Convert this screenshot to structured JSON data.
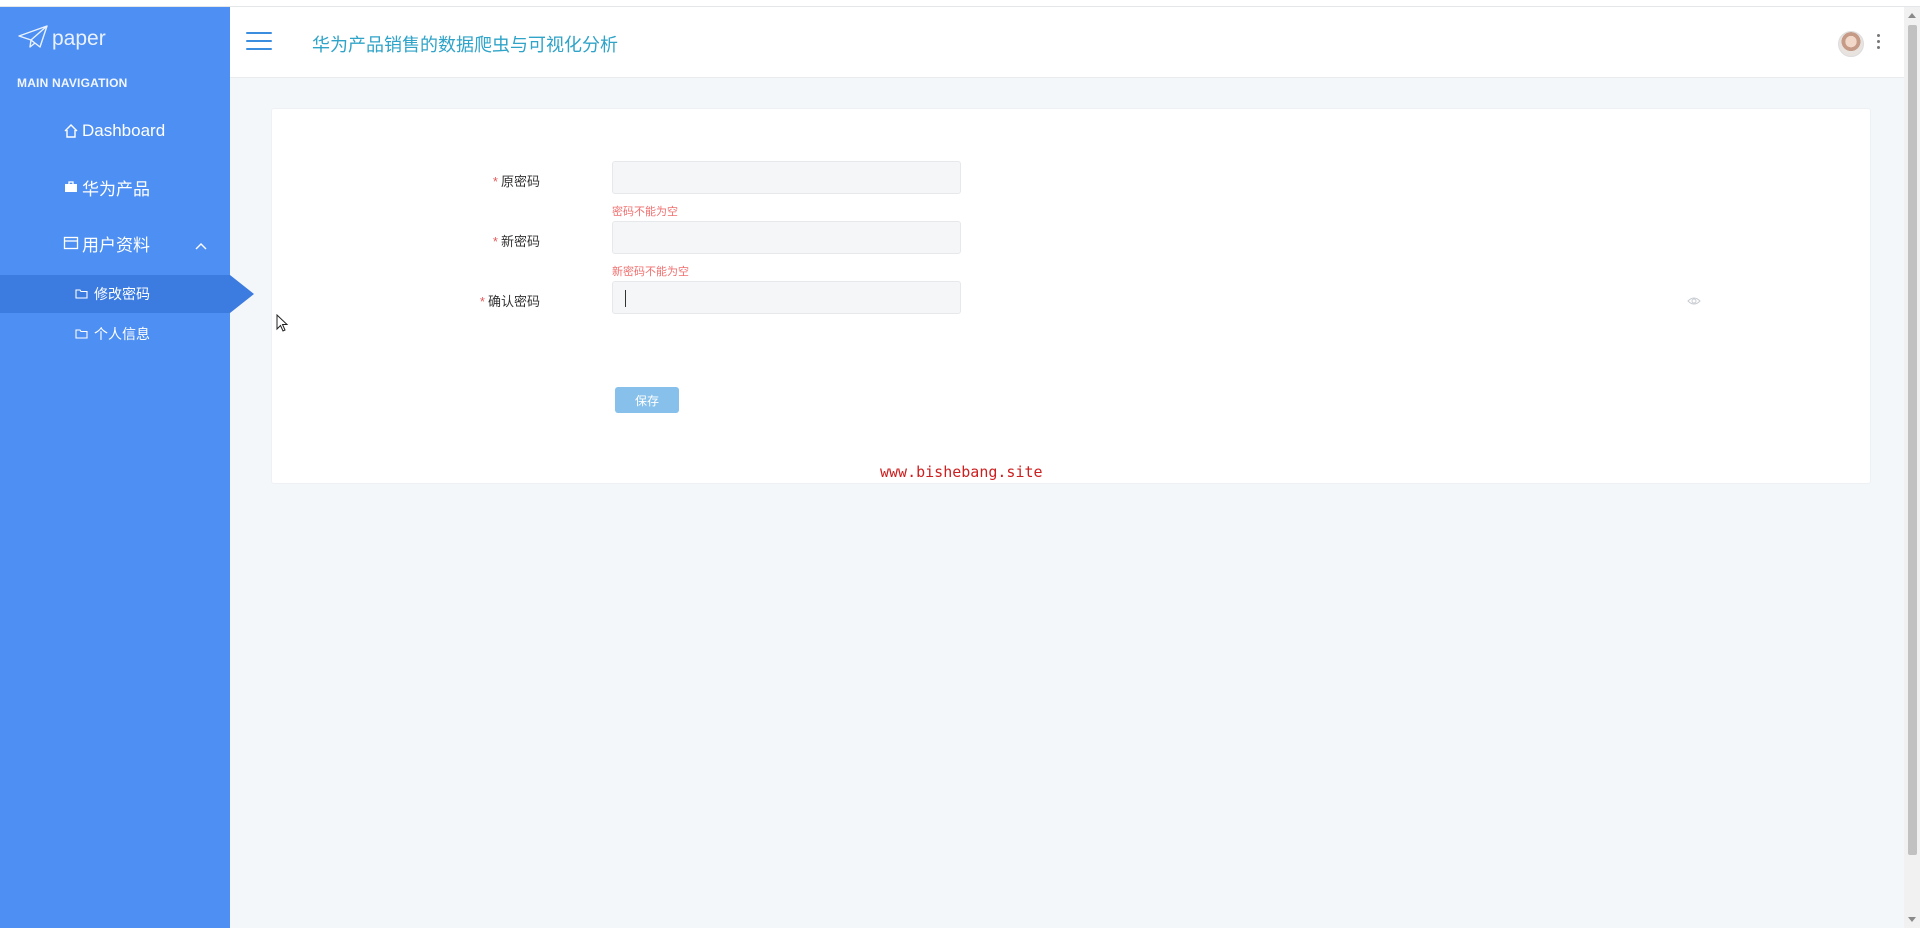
{
  "sidebar": {
    "logo_text": "paper",
    "heading": "MAIN NAVIGATION",
    "items": [
      {
        "label": "Dashboard",
        "icon": "home-icon"
      },
      {
        "label": "华为产品",
        "icon": "briefcase-icon"
      },
      {
        "label": "用户资料",
        "icon": "card-icon",
        "expanded": true
      }
    ],
    "sub_items": [
      {
        "label": "修改密码",
        "icon": "folder-icon",
        "active": true
      },
      {
        "label": "个人信息",
        "icon": "folder-icon",
        "active": false
      }
    ]
  },
  "header": {
    "title": "华为产品销售的数据爬虫与可视化分析"
  },
  "form": {
    "fields": [
      {
        "label": "原密码",
        "value": "",
        "error": "密码不能为空"
      },
      {
        "label": "新密码",
        "value": "",
        "error": "新密码不能为空"
      },
      {
        "label": "确认密码",
        "value": "",
        "error": ""
      }
    ],
    "required_mark": "*",
    "save_label": "保存"
  },
  "watermark": "www.bishebang.site",
  "colors": {
    "sidebar": "#4d8ff2",
    "active": "#3c7be0",
    "title": "#2fa3c8",
    "error": "#f07070",
    "button": "#86c0eb"
  }
}
